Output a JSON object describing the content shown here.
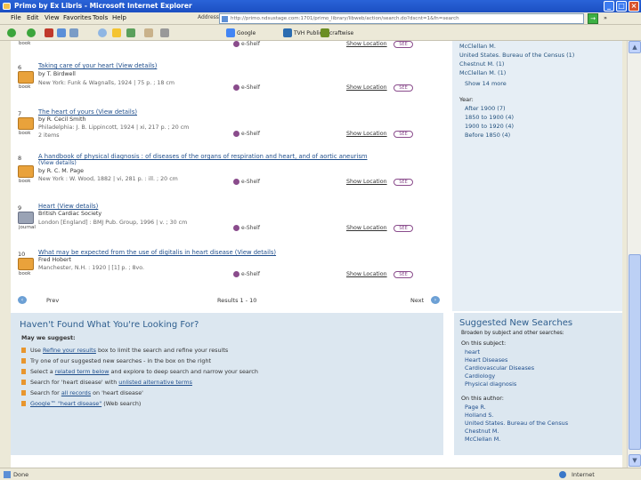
{
  "window": {
    "title": "Primo by Ex Libris - Microsoft Internet Explorer"
  },
  "menu": [
    "File",
    "Edit",
    "View",
    "Favorites",
    "Tools",
    "Help"
  ],
  "address": {
    "label": "Address",
    "url": "http://primo.ndsustage.com:1701/primo_library/libweb/action/search.do?dscnt=1&fn=search"
  },
  "links_label": "»",
  "toolbar": {
    "google": "Google",
    "tvh": "TVH Public",
    "other": "craftwise"
  },
  "results": [
    {
      "num": "6",
      "title": "Taking care of your heart (View details)",
      "line1": "by T. Birdwell",
      "line2": "New York: Funk & Wagnalls, 1924 | 75 p. ; 18 cm",
      "type": "book",
      "etag": "e-Shelf",
      "show": "Show Location",
      "see": "SEE"
    },
    {
      "num": "7",
      "title": "The heart of yours (View details)",
      "line1": "by R. Cecil Smith",
      "line2": "Philadelphia: J. B. Lippincott, 1924 | xi, 217 p. ; 20 cm",
      "line3": "2 items",
      "type": "book",
      "etag": "e-Shelf",
      "show": "Show Location",
      "see": "SEE"
    },
    {
      "num": "8",
      "title": "A handbook of physical diagnosis : of diseases of the organs of respiration and heart, and of aortic aneurism",
      "title2": "(View details)",
      "line1": "by R. C. M. Page",
      "line2": "New York : W. Wood, 1882 | vi, 281 p. : ill. ; 20 cm",
      "type": "book",
      "etag": "e-Shelf",
      "show": "Show Location",
      "see": "SEE"
    },
    {
      "num": "9",
      "title": "Heart (View details)",
      "line1": "British Cardiac Society",
      "line2": "London [England] : BMJ Pub. Group, 1996 | v. ; 30 cm",
      "type": "journal",
      "etag": "e-Shelf",
      "show": "Show Location",
      "see": "SEE"
    },
    {
      "num": "10",
      "title": "What may be expected from the use of digitalis in heart disease (View details)",
      "line1": "Fred Hobert",
      "line2": "Manchester, N.H. : 1920 | [1] p. ; 8vo.",
      "type": "book",
      "etag": "e-Shelf",
      "show": "Show Location",
      "see": "SEE"
    }
  ],
  "facets": {
    "top": [
      "McClellan M.",
      "United States. Bureau of the Census (1)",
      "Chestnut M. (1)",
      "McClellan M. (1)"
    ],
    "show_more": "Show 14 more",
    "year_label": "Year:",
    "years": [
      "After 1900 (7)",
      "1850 to 1900 (4)",
      "1900 to 1920 (4)",
      "Before 1850 (4)"
    ]
  },
  "pager": {
    "prev": "Prev",
    "results": "Results 1 - 10",
    "next": "Next"
  },
  "help": {
    "title": "Haven't Found What You're Looking For?",
    "suggest": "May we suggest:",
    "items": [
      {
        "pre": "Use ",
        "link": "Refine your results",
        "post": " box to limit the search and refine your results"
      },
      {
        "pre": "Try one of our suggested new searches - in the box on the right",
        "link": "",
        "post": ""
      },
      {
        "pre": "Select a ",
        "link": "related term below",
        "post": " and explore to deep search and narrow your search"
      },
      {
        "pre": "Search for 'heart disease' with ",
        "link": "unlisted alternative terms",
        "post": ""
      },
      {
        "pre": "Search for ",
        "link": "all records",
        "post": " on 'heart disease'"
      },
      {
        "pre": "",
        "link": "Google™ \"heart disease\"",
        "post": " (Web search)"
      }
    ]
  },
  "suggested": {
    "title": "Suggested New Searches",
    "intro1": "Broaden by subject and other searches:",
    "subject_label": "On this subject:",
    "subjects": [
      "heart",
      "Heart Diseases",
      "Cardiovascular Diseases",
      "Cardiology",
      "Physical diagnosis"
    ],
    "author_label": "On this author:",
    "authors": [
      "Page R.",
      "Holland S.",
      "United States. Bureau of the Census",
      "Chestnut M.",
      "McClellan M."
    ]
  },
  "status": {
    "left": "Done",
    "zone": "Internet"
  }
}
